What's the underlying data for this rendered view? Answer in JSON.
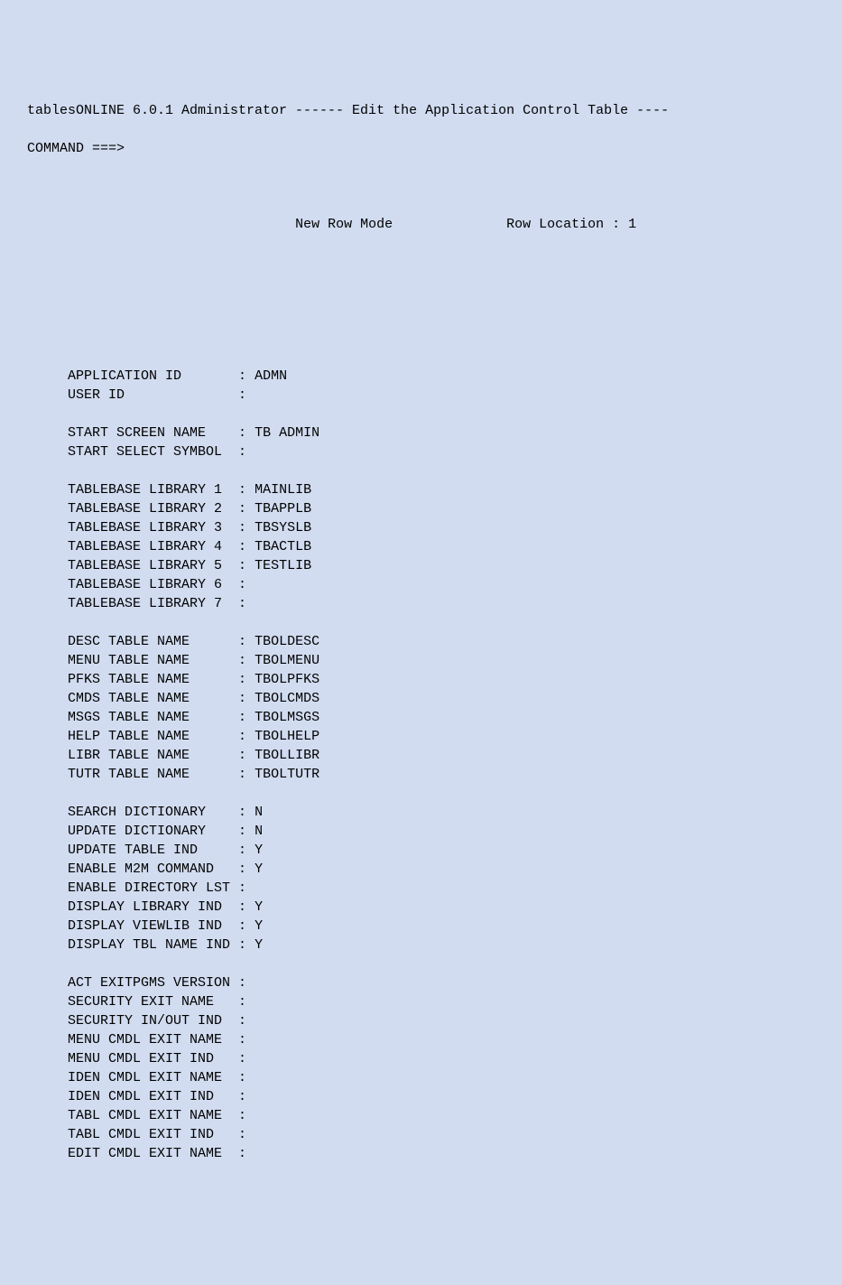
{
  "header": {
    "title": "tablesONLINE 6.0.1 Administrator ------ Edit the Application Control Table ----",
    "command_prefix": "COMMAND ===>",
    "command_value": "",
    "mode": "New Row Mode",
    "row_location_label": "Row Location",
    "row_location_value": "1"
  },
  "fields": [
    {
      "name": "application-id",
      "label": "APPLICATION ID      ",
      "value": "ADMN"
    },
    {
      "name": "user-id",
      "label": "USER ID             ",
      "value": ""
    },
    {
      "name": "gap",
      "gap": true
    },
    {
      "name": "start-screen-name",
      "label": "START SCREEN NAME   ",
      "value": "TB ADMIN"
    },
    {
      "name": "start-select-symbol",
      "label": "START SELECT SYMBOL ",
      "value": ""
    },
    {
      "name": "gap",
      "gap": true
    },
    {
      "name": "tablebase-library-1",
      "label": "TABLEBASE LIBRARY 1 ",
      "value": "MAINLIB"
    },
    {
      "name": "tablebase-library-2",
      "label": "TABLEBASE LIBRARY 2 ",
      "value": "TBAPPLB"
    },
    {
      "name": "tablebase-library-3",
      "label": "TABLEBASE LIBRARY 3 ",
      "value": "TBSYSLB"
    },
    {
      "name": "tablebase-library-4",
      "label": "TABLEBASE LIBRARY 4 ",
      "value": "TBACTLB"
    },
    {
      "name": "tablebase-library-5",
      "label": "TABLEBASE LIBRARY 5 ",
      "value": "TESTLIB"
    },
    {
      "name": "tablebase-library-6",
      "label": "TABLEBASE LIBRARY 6 ",
      "value": ""
    },
    {
      "name": "tablebase-library-7",
      "label": "TABLEBASE LIBRARY 7 ",
      "value": ""
    },
    {
      "name": "gap",
      "gap": true
    },
    {
      "name": "desc-table-name",
      "label": "DESC TABLE NAME     ",
      "value": "TBOLDESC"
    },
    {
      "name": "menu-table-name",
      "label": "MENU TABLE NAME     ",
      "value": "TBOLMENU"
    },
    {
      "name": "pfks-table-name",
      "label": "PFKS TABLE NAME     ",
      "value": "TBOLPFKS"
    },
    {
      "name": "cmds-table-name",
      "label": "CMDS TABLE NAME     ",
      "value": "TBOLCMDS"
    },
    {
      "name": "msgs-table-name",
      "label": "MSGS TABLE NAME     ",
      "value": "TBOLMSGS"
    },
    {
      "name": "help-table-name",
      "label": "HELP TABLE NAME     ",
      "value": "TBOLHELP"
    },
    {
      "name": "libr-table-name",
      "label": "LIBR TABLE NAME     ",
      "value": "TBOLLIBR"
    },
    {
      "name": "tutr-table-name",
      "label": "TUTR TABLE NAME     ",
      "value": "TBOLTUTR"
    },
    {
      "name": "gap",
      "gap": true
    },
    {
      "name": "search-dictionary",
      "label": "SEARCH DICTIONARY   ",
      "value": "N"
    },
    {
      "name": "update-dictionary",
      "label": "UPDATE DICTIONARY   ",
      "value": "N"
    },
    {
      "name": "update-table-ind",
      "label": "UPDATE TABLE IND    ",
      "value": "Y"
    },
    {
      "name": "enable-m2m-command",
      "label": "ENABLE M2M COMMAND  ",
      "value": "Y"
    },
    {
      "name": "enable-directory-lst",
      "label": "ENABLE DIRECTORY LST",
      "value": ""
    },
    {
      "name": "display-library-ind",
      "label": "DISPLAY LIBRARY IND ",
      "value": "Y"
    },
    {
      "name": "display-viewlib-ind",
      "label": "DISPLAY VIEWLIB IND ",
      "value": "Y"
    },
    {
      "name": "display-tbl-name-ind",
      "label": "DISPLAY TBL NAME IND",
      "value": "Y"
    },
    {
      "name": "gap",
      "gap": true
    },
    {
      "name": "act-exitpgms-version",
      "label": "ACT EXITPGMS VERSION",
      "value": ""
    },
    {
      "name": "security-exit-name",
      "label": "SECURITY EXIT NAME  ",
      "value": ""
    },
    {
      "name": "security-in-out-ind",
      "label": "SECURITY IN/OUT IND ",
      "value": ""
    },
    {
      "name": "menu-cmdl-exit-name",
      "label": "MENU CMDL EXIT NAME ",
      "value": ""
    },
    {
      "name": "menu-cmdl-exit-ind",
      "label": "MENU CMDL EXIT IND  ",
      "value": ""
    },
    {
      "name": "iden-cmdl-exit-name",
      "label": "IDEN CMDL EXIT NAME ",
      "value": ""
    },
    {
      "name": "iden-cmdl-exit-ind",
      "label": "IDEN CMDL EXIT IND  ",
      "value": ""
    },
    {
      "name": "tabl-cmdl-exit-name",
      "label": "TABL CMDL EXIT NAME ",
      "value": ""
    },
    {
      "name": "tabl-cmdl-exit-ind",
      "label": "TABL CMDL EXIT IND  ",
      "value": ""
    },
    {
      "name": "edit-cmdl-exit-name",
      "label": "EDIT CMDL EXIT NAME ",
      "value": ""
    }
  ]
}
